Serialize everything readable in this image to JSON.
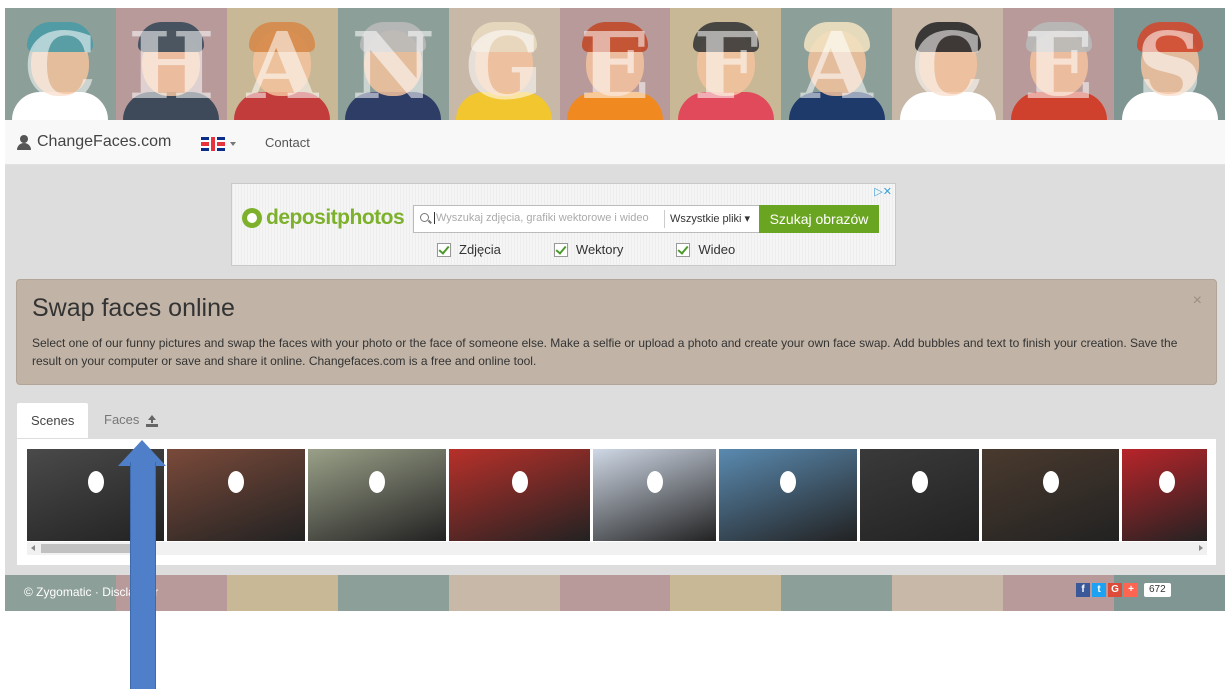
{
  "banner": {
    "letters": [
      "C",
      "H",
      "A",
      "N",
      "G",
      "E",
      "F",
      "A",
      "C",
      "E",
      "S"
    ],
    "tile_colors": [
      "#8c9f99",
      "#b89a9a",
      "#c8b896",
      "#8c9f99",
      "#c8b8a8",
      "#b89a9a",
      "#c8b896",
      "#8c9f99",
      "#c8b8a8",
      "#b89a9a",
      "#7f9692"
    ],
    "body_colors": [
      "#ffffff",
      "#3e4a5a",
      "#c23c3c",
      "#2e3d66",
      "#f2c62f",
      "#f08a20",
      "#e04a5a",
      "#1e3a6a",
      "#ffffff",
      "#d0412d",
      "#ffffff"
    ],
    "hair_colors": [
      "#4a9aa6",
      "#3a4a5a",
      "#d6894a",
      "#b9b9b9",
      "#e8d9c0",
      "#c04a2a",
      "#3a3a3a",
      "#f0e0c0",
      "#2a2a2a",
      "#b9b9b9",
      "#d04a30"
    ]
  },
  "navbar": {
    "brand": "ChangeFaces.com",
    "language_flag": "uk-flag",
    "contact": "Contact"
  },
  "ad": {
    "logo_text": "depositphotos",
    "search_placeholder": "Wyszukaj zdjęcia, grafiki wektorowe i wideo",
    "filter_select": "Wszystkie pliki ▾",
    "search_button": "Szukaj obrazów",
    "checks": [
      "Zdjęcia",
      "Wektory",
      "Wideo"
    ],
    "choices": "▷✕"
  },
  "alert": {
    "title": "Swap faces online",
    "text": "Select one of our funny pictures and swap the faces with your photo or the face of someone else. Make a selfie or upload a photo and create your own face swap. Add bubbles and text to finish your creation. Save the result on your computer or save and share it online. Changefaces.com is a free and online tool.",
    "close": "×"
  },
  "tabs": {
    "scenes": "Scenes",
    "faces": "Faces"
  },
  "thumbnails": [
    {
      "name": "lincoln-statue",
      "color": "#4a4a4a"
    },
    {
      "name": "bartender",
      "color": "#7a4a3a"
    },
    {
      "name": "dollar-bill",
      "color": "#9aa088"
    },
    {
      "name": "football-player",
      "color": "#b8302a"
    },
    {
      "name": "angel-baby",
      "color": "#cfd8e6"
    },
    {
      "name": "yoga-couple",
      "color": "#5a8ab0"
    },
    {
      "name": "party-crowd",
      "color": "#3a3a3a"
    },
    {
      "name": "celebration-group",
      "color": "#4a3a2e"
    },
    {
      "name": "santa-claus",
      "color": "#b8242a"
    }
  ],
  "footer": {
    "copyright": "© Zygomatic · Disclaimer",
    "share_count": "672",
    "colors": [
      "#8c9f99",
      "#b89a9a",
      "#c8b896",
      "#8c9f99",
      "#c8b8a8",
      "#b89a9a",
      "#c8b896",
      "#8c9f99",
      "#c8b8a8",
      "#b89a9a",
      "#7f9692"
    ]
  }
}
